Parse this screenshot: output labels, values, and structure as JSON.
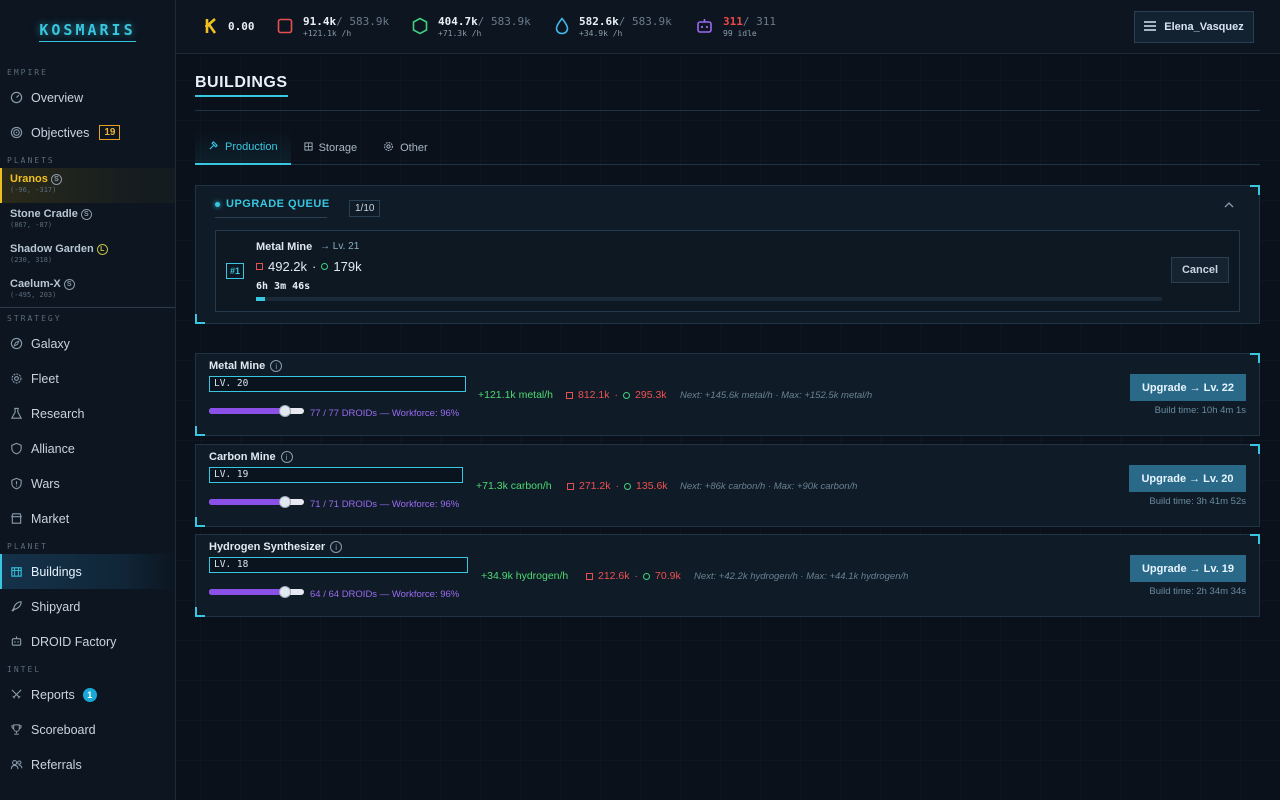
{
  "app": {
    "logo": "KOSMARIS"
  },
  "sidebar": {
    "sections": {
      "empire": "EMPIRE",
      "planets": "PLANETS",
      "strategy": "STRATEGY",
      "planet": "PLANET",
      "intel": "INTEL"
    },
    "empire": [
      {
        "label": "Overview",
        "icon": "gauge-icon"
      },
      {
        "label": "Objectives",
        "icon": "target-icon",
        "badge": "19"
      }
    ],
    "planets": [
      {
        "name": "Uranos",
        "size": "S",
        "coords": "(-96, -317)"
      },
      {
        "name": "Stone Cradle",
        "size": "S",
        "coords": "(867, -87)"
      },
      {
        "name": "Shadow Garden",
        "size": "L",
        "coords": "(230, 318)"
      },
      {
        "name": "Caelum-X",
        "size": "S",
        "coords": "(-495, 203)"
      }
    ],
    "strategy": [
      {
        "label": "Galaxy",
        "icon": "compass-icon"
      },
      {
        "label": "Fleet",
        "icon": "gear-icon"
      },
      {
        "label": "Research",
        "icon": "flask-icon"
      },
      {
        "label": "Alliance",
        "icon": "shield-icon"
      },
      {
        "label": "Wars",
        "icon": "shield-alert-icon"
      },
      {
        "label": "Market",
        "icon": "store-icon"
      }
    ],
    "planet": [
      {
        "label": "Buildings",
        "icon": "building-icon"
      },
      {
        "label": "Shipyard",
        "icon": "rocket-icon"
      },
      {
        "label": "DROID Factory",
        "icon": "robot-icon"
      }
    ],
    "intel": [
      {
        "label": "Reports",
        "icon": "swords-icon",
        "badge": "1"
      },
      {
        "label": "Scoreboard",
        "icon": "trophy-icon"
      },
      {
        "label": "Referrals",
        "icon": "users-icon"
      }
    ]
  },
  "topbar": {
    "credits": {
      "value": "0.00",
      "icon": "k-coin-icon"
    },
    "metal": {
      "value": "91.4k",
      "max": "/ 583.9k",
      "rate": "+121.1k /h"
    },
    "carbon": {
      "value": "404.7k",
      "max": "/ 583.9k",
      "rate": "+71.3k /h"
    },
    "hydrogen": {
      "value": "582.6k",
      "max": "/ 583.9k",
      "rate": "+34.9k /h"
    },
    "droids": {
      "value": "311",
      "max": "/ 311",
      "sub": "99 idle"
    },
    "user": "Elena_Vasquez",
    "colors": {
      "metal": "#e85050",
      "carbon": "#40d080",
      "hydrogen": "#40b8e8",
      "droids": "#9a6af0"
    }
  },
  "page": {
    "title": "BUILDINGS"
  },
  "tabs": [
    {
      "label": "Production",
      "icon": "hammer-icon",
      "active": true
    },
    {
      "label": "Storage",
      "icon": "box-icon"
    },
    {
      "label": "Other",
      "icon": "gear-icon"
    }
  ],
  "queue": {
    "title": "UPGRADE QUEUE",
    "count": "1/10",
    "item": {
      "num": "#1",
      "name": "Metal Mine",
      "target": "→ Lv. 21",
      "metal_cost": "492.2k",
      "sep": "·",
      "carbon_cost": "179k",
      "time": "6h 3m 46s",
      "progress": 0.01,
      "cancel": "Cancel"
    }
  },
  "buildings": [
    {
      "name": "Metal Mine",
      "level": "LV. 20",
      "droids": "77 / 77 DROIDs — Workforce: 96%",
      "slider": 0.8,
      "production": "+121.1k metal/h",
      "metal_cost": "812.1k",
      "sep": "·",
      "carbon_cost": "295.3k",
      "next": "Next: +145.6k metal/h · Max: +152.5k metal/h",
      "upgrade": "Upgrade → Lv. 22",
      "build_time": "Build time: 10h 4m 1s"
    },
    {
      "name": "Carbon Mine",
      "level": "LV. 19",
      "droids": "71 / 71 DROIDs — Workforce: 96%",
      "slider": 0.8,
      "production": "+71.3k carbon/h",
      "metal_cost": "271.2k",
      "sep": "·",
      "carbon_cost": "135.6k",
      "next": "Next: +86k carbon/h · Max: +90k carbon/h",
      "upgrade": "Upgrade → Lv. 20",
      "build_time": "Build time: 3h 41m 52s"
    },
    {
      "name": "Hydrogen Synthesizer",
      "level": "LV. 18",
      "droids": "64 / 64 DROIDs — Workforce: 96%",
      "slider": 0.8,
      "production": "+34.9k hydrogen/h",
      "metal_cost": "212.6k",
      "sep": "·",
      "carbon_cost": "70.9k",
      "next": "Next: +42.2k hydrogen/h · Max: +44.1k hydrogen/h",
      "upgrade": "Upgrade → Lv. 19",
      "build_time": "Build time: 2h 34m 34s"
    }
  ]
}
